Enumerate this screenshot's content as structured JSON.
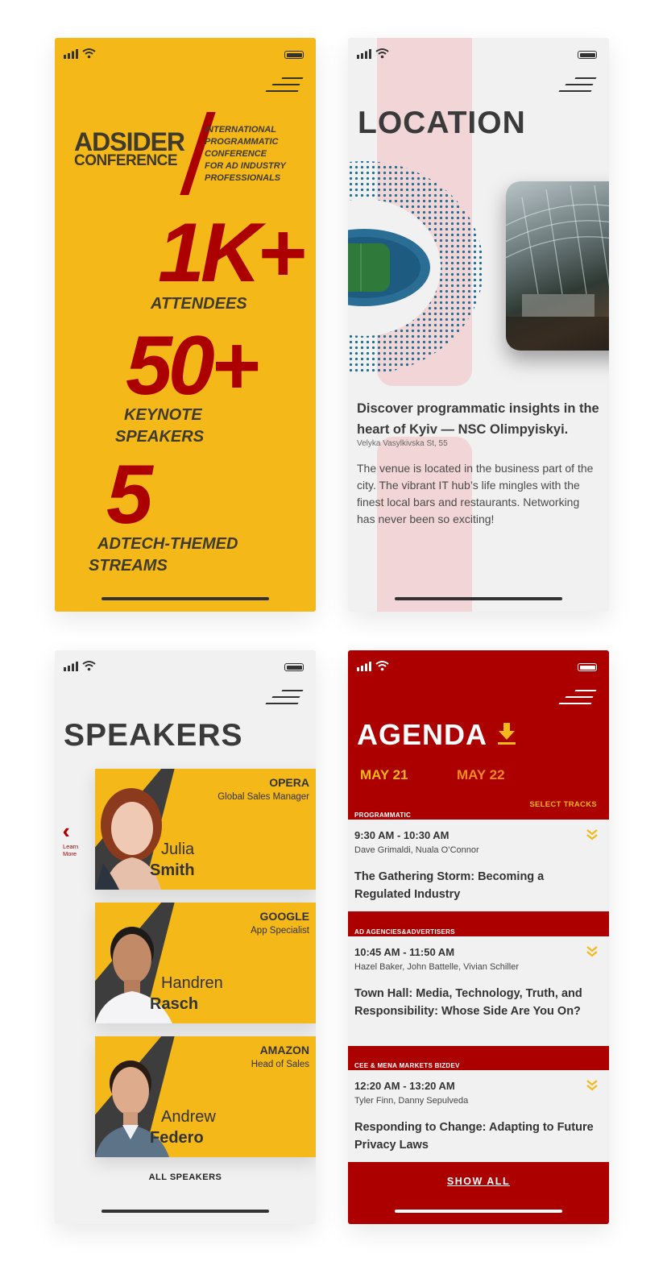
{
  "screens": {
    "stats": {
      "logo_line1": "ADSIDER",
      "logo_line2": "CONFERENCE",
      "tagline": [
        "INTERNATIONAL",
        "PROGRAMMATIC",
        "CONFERENCE",
        "FOR AD INDUSTRY",
        "PROFESSIONALS"
      ],
      "stats": [
        {
          "value": "1K+",
          "label": [
            "ATTENDEES"
          ]
        },
        {
          "value": "50+",
          "label": [
            "KEYNOTE",
            "SPEAKERS"
          ]
        },
        {
          "value": "5",
          "label": [
            "ADTECH-THEMED",
            "STREAMS"
          ]
        }
      ]
    },
    "location": {
      "title": "LOCATION",
      "headline": "Discover programmatic insights in the heart of Kyiv — NSC Olimpyiskyi.",
      "address": "Velyka Vasylkivska St, 55",
      "body": "The venue is located in the business part of the city. The vibrant IT hub’s life mingles with the finest local bars and restaurants. Networking has never been so exciting!"
    },
    "speakers": {
      "title": "SPEAKERS",
      "learn_more": "Learn More",
      "all_speakers": "ALL SPEAKERS",
      "items": [
        {
          "company": "OPERA",
          "role": "Global Sales Manager",
          "first": "Julia",
          "last": "Smith"
        },
        {
          "company": "GOOGLE",
          "role": "App Specialist",
          "first": "Handren",
          "last": "Rasch"
        },
        {
          "company": "AMAZON",
          "role": "Head of Sales",
          "first": "Andrew",
          "last": "Federo"
        }
      ]
    },
    "agenda": {
      "title": "AGENDA",
      "days": [
        "MAY 21",
        "MAY 22"
      ],
      "select_tracks": "SELECT TRACKS",
      "show_all": "SHOW ALL",
      "sessions": [
        {
          "track": "PROGRAMMATIC",
          "time": "9:30 AM - 10:30 AM",
          "speakers": "Dave Grimaldi, Nuala O’Connor",
          "title": "The Gathering Storm: Becoming a Regulated Industry"
        },
        {
          "track": "AD AGENCIES&ADVERTISERS",
          "time": "10:45 AM - 11:50 AM",
          "speakers": "Hazel Baker, John Battelle, Vivian Schiller",
          "title": "Town Hall: Media, Technology, Truth, and Responsibility: Whose Side Are You On?"
        },
        {
          "track": "CEE & MENA MARKETS BIZDEV",
          "time": "12:20 AM - 13:20 AM",
          "speakers": "Tyler Finn, Danny Sepulveda",
          "title": "Responding to Change: Adapting to Future Privacy Laws"
        }
      ]
    }
  },
  "colors": {
    "yellow": "#F4B818",
    "red": "#AC0000",
    "dark_text": "#3a3a3a",
    "light_bg": "#F1F1F1",
    "pink": "#F2D5D6",
    "day_active": "#F4B818",
    "day_inactive": "#F08A24"
  },
  "icons": [
    "signal-icon",
    "wifi-icon",
    "battery-icon",
    "menu-icon",
    "download-icon",
    "chevron-double-left-icon",
    "chevron-double-down-icon"
  ]
}
